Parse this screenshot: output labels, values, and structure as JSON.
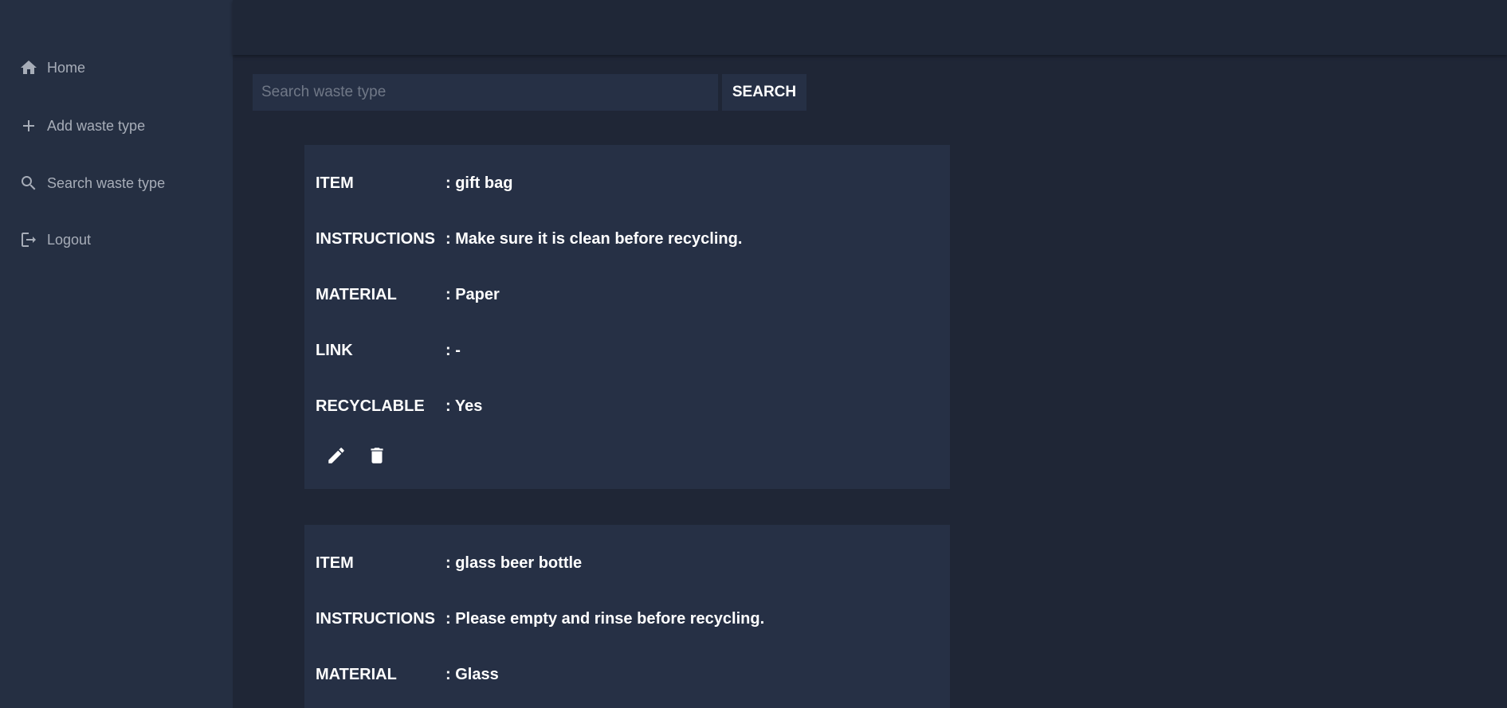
{
  "sidebar": {
    "items": [
      {
        "label": "Home",
        "icon": "home-icon"
      },
      {
        "label": "Add waste type",
        "icon": "plus-icon"
      },
      {
        "label": "Search waste type",
        "icon": "search-icon"
      },
      {
        "label": "Logout",
        "icon": "logout-icon"
      }
    ]
  },
  "search": {
    "placeholder": "Search waste type",
    "value": "",
    "button_label": "SEARCH"
  },
  "cards": [
    {
      "fields": [
        {
          "label": "ITEM",
          "value": ": gift bag"
        },
        {
          "label": "INSTRUCTIONS",
          "value": ": Make sure it is clean before recycling."
        },
        {
          "label": "MATERIAL",
          "value": ": Paper"
        },
        {
          "label": "LINK",
          "value": ": -"
        },
        {
          "label": "RECYCLABLE",
          "value": ": Yes"
        }
      ],
      "actions": [
        "edit-icon",
        "delete-icon"
      ]
    },
    {
      "fields": [
        {
          "label": "ITEM",
          "value": ": glass beer bottle"
        },
        {
          "label": "INSTRUCTIONS",
          "value": ": Please empty and rinse before recycling."
        },
        {
          "label": "MATERIAL",
          "value": ": Glass"
        }
      ]
    }
  ],
  "colors": {
    "sidebar_bg": "#252f42",
    "page_bg": "#1f2636",
    "card_bg": "#263045",
    "nav_text": "#a7adb8",
    "text": "#ffffff"
  }
}
